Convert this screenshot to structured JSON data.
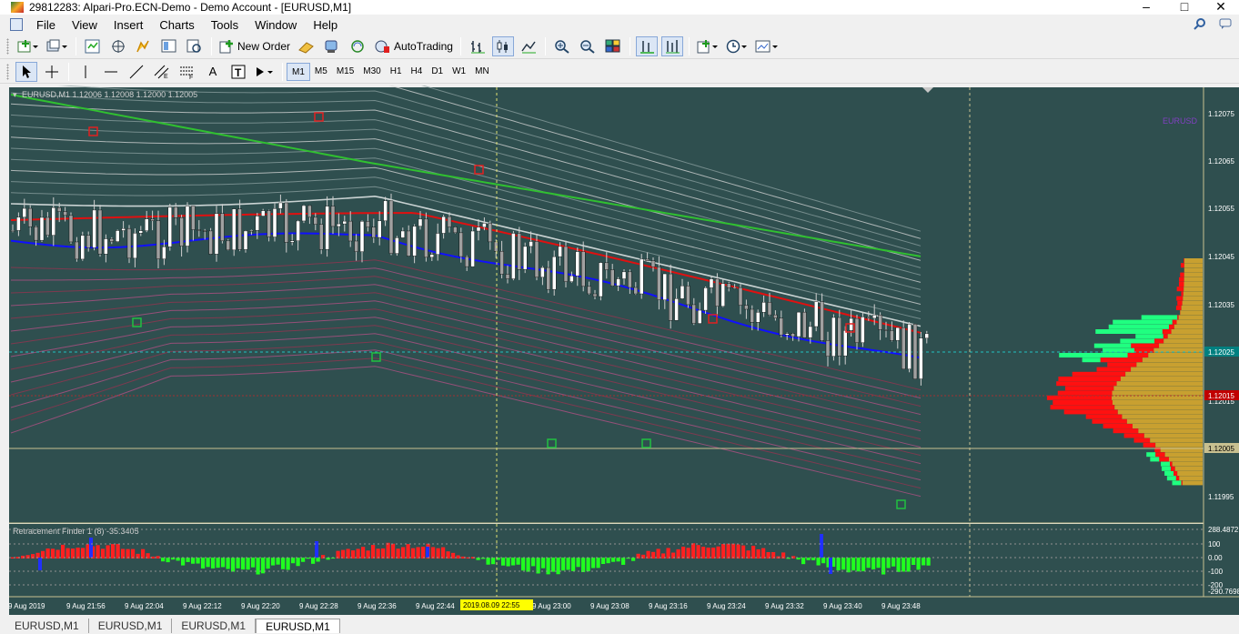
{
  "window": {
    "title": "29812283: Alpari-Pro.ECN-Demo - Demo Account - [EURUSD,M1]",
    "minimize_icon": "minimize-icon",
    "maximize_icon": "maximize-icon",
    "close_icon": "close-icon"
  },
  "menu": {
    "items": [
      "File",
      "View",
      "Insert",
      "Charts",
      "Tools",
      "Window",
      "Help"
    ]
  },
  "toolbar": {
    "new_order_label": "New Order",
    "autotrading_label": "AutoTrading",
    "timeframes": [
      "M1",
      "M5",
      "M15",
      "M30",
      "H1",
      "H4",
      "D1",
      "W1",
      "MN"
    ],
    "active_timeframe": "M1"
  },
  "chart": {
    "header_text": "EURUSD,M1  1.12006 1.12008 1.12000 1.12005",
    "symbol_overlay": "EURUSD",
    "background": "#2f4f4f",
    "price_labels": [
      "1.12075",
      "1.12065",
      "1.12055",
      "1.12045",
      "1.12035",
      "1.12025",
      "1.12015",
      "1.12005",
      "1.11995"
    ],
    "current_price": "1.12025",
    "red_line_price": "1.12015",
    "bid_price": "1.12005",
    "time_labels": [
      "9 Aug 2019",
      "9 Aug 21:56",
      "9 Aug 22:04",
      "9 Aug 22:12",
      "9 Aug 22:20",
      "9 Aug 22:28",
      "9 Aug 22:36",
      "9 Aug 22:44",
      "9 Aug 23:00",
      "9 Aug 23:08",
      "9 Aug 23:16",
      "9 Aug 23:24",
      "9 Aug 23:32",
      "9 Aug 23:40",
      "9 Aug 23:48"
    ],
    "crosshair_time": "2019.08.09 22:55",
    "indicator": {
      "name": "Retracement Finder 1 (8) -35.3405",
      "labels": [
        "288.4872",
        "100",
        "0.00",
        "-100",
        "-200",
        "-290.7698"
      ]
    },
    "colors": {
      "up": "#ffffff",
      "down": "#a0a0a0",
      "ma_fast": "#1010ff",
      "ma_mid": "#e01010",
      "ma_slow": "#30c030",
      "hist_pos": "#ff2020",
      "hist_neg": "#20ff20",
      "profile_gold": "#c8a030",
      "profile_red": "#ff1010",
      "profile_green": "#20ff80"
    }
  },
  "tabs": [
    "EURUSD,M1",
    "EURUSD,M1",
    "EURUSD,M1",
    "EURUSD,M1"
  ],
  "active_tab": 3
}
